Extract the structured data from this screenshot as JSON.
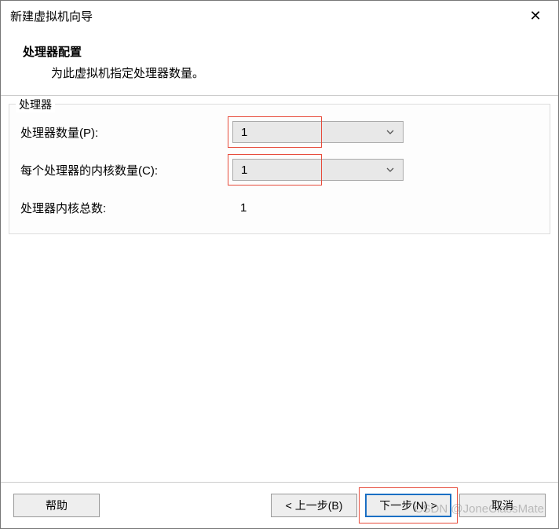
{
  "window": {
    "title": "新建虚拟机向导"
  },
  "header": {
    "title": "处理器配置",
    "description": "为此虚拟机指定处理器数量。"
  },
  "group": {
    "label": "处理器",
    "rows": {
      "processors": {
        "label": "处理器数量(P):",
        "value": "1"
      },
      "cores": {
        "label": "每个处理器的内核数量(C):",
        "value": "1"
      },
      "total": {
        "label": "处理器内核总数:",
        "value": "1"
      }
    }
  },
  "footer": {
    "help": "帮助",
    "back": "< 上一步(B)",
    "next": "下一步(N) >",
    "cancel": "取消"
  },
  "watermark": "CSDN @JoneClassMate"
}
